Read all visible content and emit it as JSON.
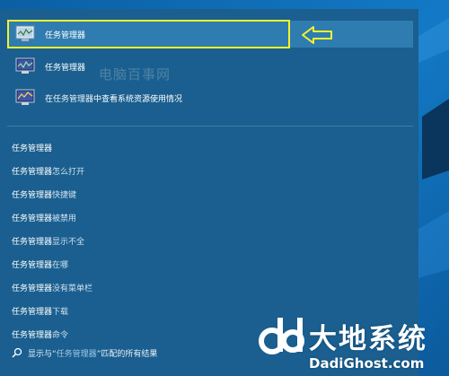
{
  "colors": {
    "panel_bg": "#1a5f8f",
    "selected_bg": "#2f7cb0",
    "highlight_box": "#f3f32a",
    "desktop_bg": "#0d6bb0"
  },
  "top_results": [
    {
      "label": "任务管理器",
      "icon": "task-manager-icon",
      "selected": true
    },
    {
      "label": "任务管理器",
      "icon": "task-manager-icon",
      "selected": false
    },
    {
      "label_prefix": "在",
      "label_hl": "任务管理器",
      "label_suffix": "中查看系统资源使用情况",
      "icon": "resource-monitor-icon",
      "selected": false
    }
  ],
  "watermark": "电脑百事网",
  "suggestions": [
    {
      "hl": "任务管理器",
      "rest": ""
    },
    {
      "hl": "任务管理器",
      "rest": "怎么打开"
    },
    {
      "hl": "任务管理器",
      "rest": "快捷键"
    },
    {
      "hl": "任务管理器",
      "rest": "被禁用"
    },
    {
      "hl": "任务管理器",
      "rest": "显示不全"
    },
    {
      "hl": "任务管理器",
      "rest": "在哪"
    },
    {
      "hl": "任务管理器",
      "rest": "没有菜单栏"
    },
    {
      "hl": "任务管理器",
      "rest": "下载"
    },
    {
      "hl": "任务管理器",
      "rest": "命令"
    }
  ],
  "search_all": {
    "prefix": "显示与“",
    "hl": "任务管理器",
    "suffix": "”匹配的所有结果",
    "icon": "search-icon"
  },
  "logo": {
    "cn": "大地系统",
    "en": "DadiGhost.com"
  }
}
